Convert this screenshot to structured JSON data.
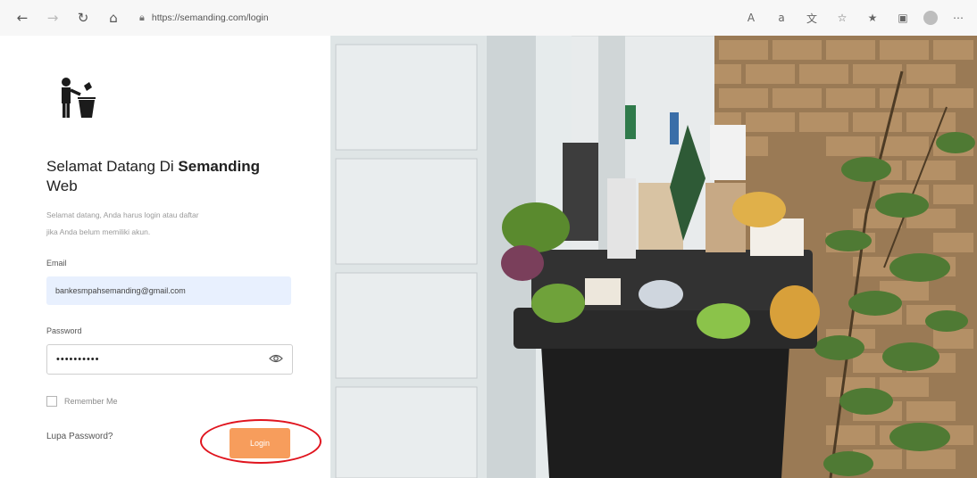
{
  "browser": {
    "url": "https://semanding.com/login",
    "icons": [
      "back-icon",
      "forward-icon",
      "refresh-icon",
      "home-icon",
      "lock-icon",
      "read-aloud-icon",
      "immersive-icon",
      "translate-icon",
      "add-favorite-icon",
      "favorites-icon",
      "collections-icon",
      "profile-icon",
      "more-icon"
    ]
  },
  "login": {
    "title_prefix": "Selamat Datang Di ",
    "title_bold": "Semanding",
    "title_suffix": "Web",
    "subtitle_line1": "Selamat datang, Anda harus login atau daftar",
    "subtitle_line2": "jika Anda belum memiliki akun.",
    "email_label": "Email",
    "email_value": "bankesmpahsemanding@gmail.com",
    "password_label": "Password",
    "password_value": "••••••••••",
    "remember_label": "Remember Me",
    "forgot_label": "Lupa Password?",
    "login_button": "Login"
  },
  "colors": {
    "accent": "#f79d5c",
    "highlight": "#e0141e",
    "input_fill": "#e8f0fe"
  },
  "photo": {
    "subject": "overflowing-trash-bin",
    "scene": [
      "white-panel-wall",
      "brick-wall",
      "green-plant"
    ]
  }
}
